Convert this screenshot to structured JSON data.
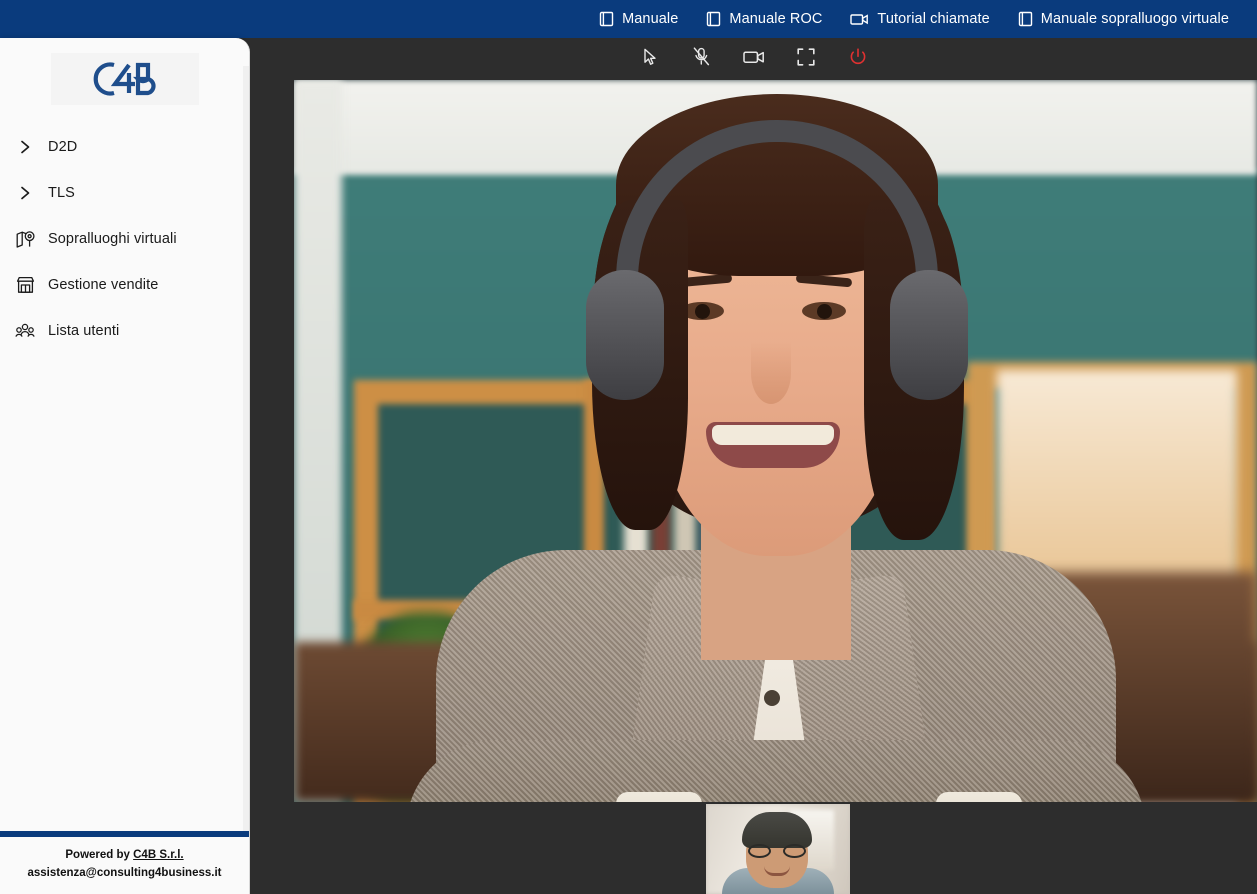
{
  "navbar": {
    "background_color": "#0a3b7d",
    "links": [
      {
        "label": "Manuale",
        "icon": "book-icon"
      },
      {
        "label": "Manuale ROC",
        "icon": "book-icon"
      },
      {
        "label": "Tutorial chiamate",
        "icon": "video-camera-icon"
      },
      {
        "label": "Manuale sopralluogo virtuale",
        "icon": "book-icon"
      }
    ]
  },
  "sidebar": {
    "logo": {
      "text": "C4B",
      "color": "#1f4e8c"
    },
    "items": [
      {
        "label": "D2D",
        "icon": "chevron-right-icon",
        "expandable": true
      },
      {
        "label": "TLS",
        "icon": "chevron-right-icon",
        "expandable": true
      },
      {
        "label": "Sopralluoghi virtuali",
        "icon": "map-pin-icon",
        "expandable": false
      },
      {
        "label": "Gestione vendite",
        "icon": "storefront-icon",
        "expandable": false
      },
      {
        "label": "Lista utenti",
        "icon": "users-group-icon",
        "expandable": false
      }
    ],
    "footer": {
      "powered_prefix": "Powered by ",
      "company": "C4B S.r.l.",
      "email": "assistenza@consulting4business.it",
      "divider_color": "#0a3b7d"
    }
  },
  "stage": {
    "background_color": "#2d2d2d",
    "toolbar": [
      {
        "name": "pointer",
        "icon": "cursor-pointer-icon",
        "state": "default",
        "color": "#e8e8e8"
      },
      {
        "name": "microphone",
        "icon": "microphone-muted-icon",
        "state": "muted",
        "color": "#e8e8e8"
      },
      {
        "name": "camera",
        "icon": "video-camera-icon",
        "state": "on",
        "color": "#e8e8e8"
      },
      {
        "name": "fullscreen",
        "icon": "fullscreen-icon",
        "state": "default",
        "color": "#e8e8e8"
      },
      {
        "name": "hangup",
        "icon": "power-off-icon",
        "state": "danger",
        "color": "#e03131"
      }
    ],
    "main_video": {
      "description": "Smiling woman wearing over-ear headphones, teal wall and wooden bookshelf behind her",
      "participant_role": "remote"
    },
    "thumbnail_video": {
      "description": "Smiling man with glasses and a beanie in a bright cafe",
      "participant_role": "self"
    }
  }
}
